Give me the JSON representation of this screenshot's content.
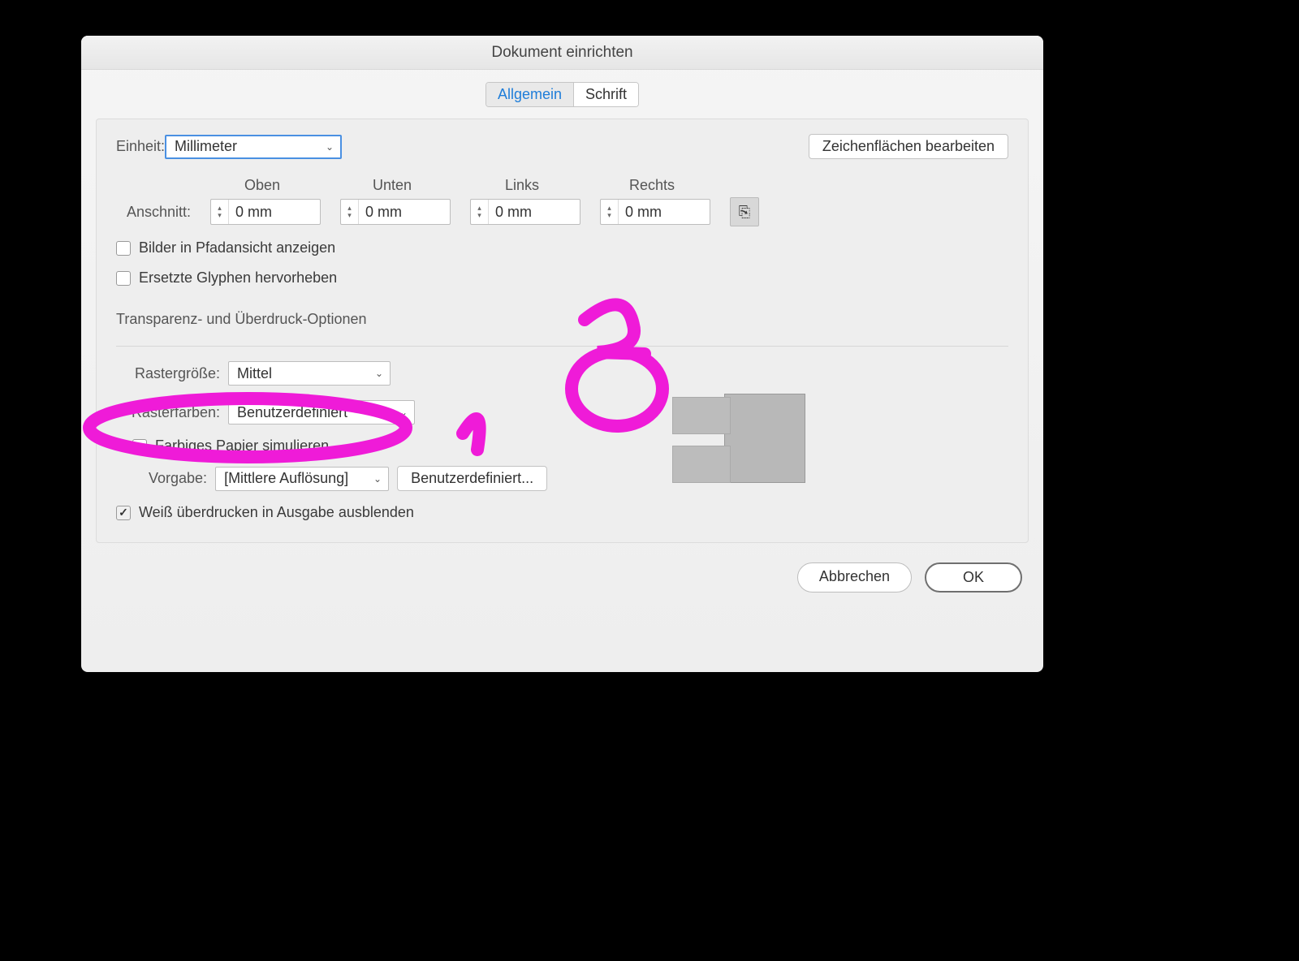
{
  "window": {
    "title": "Dokument einrichten"
  },
  "tabs": {
    "general": "Allgemein",
    "type": "Schrift"
  },
  "unit": {
    "label": "Einheit:",
    "value": "Millimeter"
  },
  "edit_artboards": "Zeichenflächen bearbeiten",
  "bleed": {
    "label": "Anschnitt:",
    "top": "Oben",
    "bottom": "Unten",
    "left": "Links",
    "right": "Rechts",
    "val_top": "0 mm",
    "val_bottom": "0 mm",
    "val_left": "0 mm",
    "val_right": "0 mm"
  },
  "images_outline": "Bilder in Pfadansicht anzeigen",
  "highlight_glyphs": "Ersetzte Glyphen hervorheben",
  "trans_section": "Transparenz- und Überdruck-Optionen",
  "grid_size": {
    "label": "Rastergröße:",
    "value": "Mittel"
  },
  "grid_colors": {
    "label": "Rasterfarben:",
    "value": "Benutzerdefiniert"
  },
  "sim_paper": "Farbiges Papier simulieren",
  "preset": {
    "label": "Vorgabe:",
    "value": "[Mittlere Auflösung]",
    "custom_btn": "Benutzerdefiniert..."
  },
  "discard_white": "Weiß überdrucken in Ausgabe ausblenden",
  "buttons": {
    "cancel": "Abbrechen",
    "ok": "OK"
  },
  "annotations": {
    "one": "1",
    "two": "2"
  }
}
